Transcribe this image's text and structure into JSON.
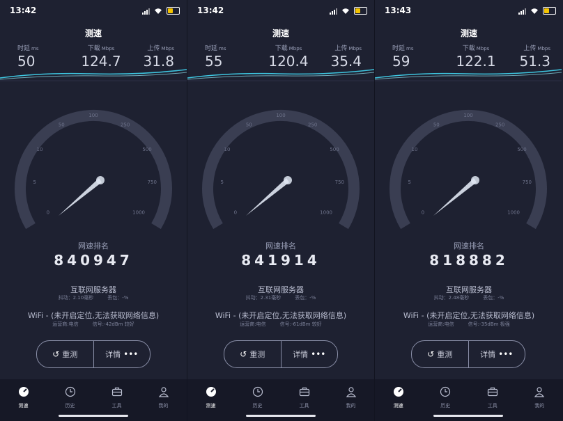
{
  "shared": {
    "title": "测速",
    "latency_label": "时延",
    "latency_unit": "ms",
    "download_label": "下载",
    "download_unit": "Mbps",
    "upload_label": "上传",
    "upload_unit": "Mbps",
    "gauge_ticks": [
      "0",
      "5",
      "10",
      "50",
      "100",
      "250",
      "500",
      "750",
      "1000"
    ],
    "rank_label": "网速排名",
    "server": "互联网服务器",
    "wifi_text": "WiFi - (未开启定位,无法获取网络信息)",
    "retest": "重测",
    "details": "详情",
    "tabs": [
      "测速",
      "历史",
      "工具",
      "我的"
    ]
  },
  "screens": [
    {
      "time": "13:42",
      "latency": "50",
      "download": "124.7",
      "upload": "31.8",
      "rank": "840947",
      "jitter": "抖动：2.10毫秒",
      "loss": "丢包：-%",
      "carrier": "运营商:电信",
      "signal": "信号:-42dBm 较好"
    },
    {
      "time": "13:42",
      "latency": "55",
      "download": "120.4",
      "upload": "35.4",
      "rank": "841914",
      "jitter": "抖动：2.31毫秒",
      "loss": "丢包：-%",
      "carrier": "运营商:电信",
      "signal": "信号:-61dBm 较好"
    },
    {
      "time": "13:43",
      "latency": "59",
      "download": "122.1",
      "upload": "51.3",
      "rank": "818882",
      "jitter": "抖动：2.48毫秒",
      "loss": "丢包：-%",
      "carrier": "运营商:电信",
      "signal": "信号:-35dBm 极强"
    }
  ],
  "colors": {
    "accent": "#3ec6e0",
    "gauge_track": "#3a3e52",
    "needle": "#dfe6f2"
  }
}
